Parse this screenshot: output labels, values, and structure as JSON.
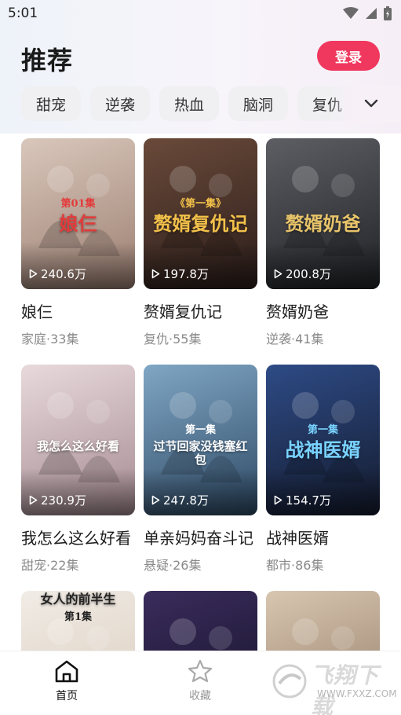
{
  "status_bar": {
    "time": "5:01"
  },
  "header": {
    "title": "推荐",
    "login_label": "登录"
  },
  "tags": [
    "甜宠",
    "逆袭",
    "热血",
    "脑洞",
    "复仇"
  ],
  "cards": [
    {
      "title": "娘仨",
      "meta": "家庭·33集",
      "plays": "240.6万",
      "poster_text": "娘仨",
      "poster_sub": "第01集",
      "palette": [
        "#d9c7bb",
        "#9c7f72"
      ],
      "text_color": "#e23b3b"
    },
    {
      "title": "赘婿复仇记",
      "meta": "复仇·55集",
      "plays": "197.8万",
      "poster_text": "赘婿复仇记",
      "poster_sub": "《第一集》",
      "palette": [
        "#6a4a3a",
        "#2b1d1a"
      ],
      "text_color": "#f2c14a"
    },
    {
      "title": "赘婿奶爸",
      "meta": "逆袭·41集",
      "plays": "200.8万",
      "poster_text": "赘婿奶爸",
      "poster_sub": "",
      "palette": [
        "#5d5e63",
        "#202226"
      ],
      "text_color": "#e8c46a"
    },
    {
      "title": "我怎么这么好看",
      "meta": "甜宠·22集",
      "plays": "230.9万",
      "poster_text": "我怎么这么好看",
      "poster_sub": "",
      "palette": [
        "#e8d9dc",
        "#a58b92"
      ],
      "text_color": "#ffffff"
    },
    {
      "title": "单亲妈妈奋斗记",
      "meta": "悬疑·26集",
      "plays": "247.8万",
      "poster_text": "过节回家没钱塞红包",
      "poster_sub": "第一集",
      "palette": [
        "#7fa6c4",
        "#2f4a66"
      ],
      "text_color": "#ffffff"
    },
    {
      "title": "战神医婿",
      "meta": "都市·86集",
      "plays": "154.7万",
      "poster_text": "战神医婿",
      "poster_sub": "第一集",
      "palette": [
        "#2e4b86",
        "#141b2e"
      ],
      "text_color": "#79d3ff"
    },
    {
      "title": "",
      "meta": "",
      "plays": "",
      "poster_text": "女人的前半生",
      "poster_sub": "第1集",
      "palette": [
        "#f1ece6",
        "#d7c8b8"
      ],
      "text_color": "#222222"
    },
    {
      "title": "",
      "meta": "",
      "plays": "",
      "poster_text": "",
      "poster_sub": "",
      "palette": [
        "#3a2c5c",
        "#121024"
      ],
      "text_color": "#ffffff"
    },
    {
      "title": "",
      "meta": "",
      "plays": "",
      "poster_text": "",
      "poster_sub": "",
      "palette": [
        "#d8c6b0",
        "#8e7662"
      ],
      "text_color": "#ffffff"
    }
  ],
  "tabbar": {
    "items": [
      {
        "label": "首页",
        "icon": "home-icon",
        "active": true
      },
      {
        "label": "收藏",
        "icon": "star-icon",
        "active": false
      }
    ]
  },
  "watermark": {
    "main": "飞翔下载",
    "url": "WWW.FXXZ.COM"
  },
  "colors": {
    "accent": "#f0375d",
    "tab_active": "#111111",
    "tab_inactive": "#999999"
  }
}
